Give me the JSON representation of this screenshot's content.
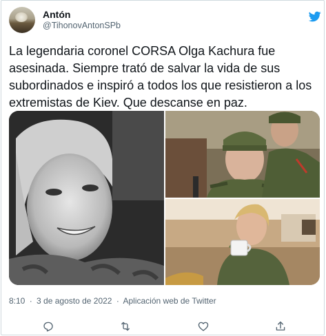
{
  "author": {
    "name": "Antón",
    "handle": "@TihonovAntonSPb",
    "avatar_icon": "avatar-photo"
  },
  "tweet": {
    "text": "La legendaria coronel CORSA Olga Kachura fue asesinada. Siempre trató de salvar la vida de sus subordinados e inspiró a todos los que resistieron a los extremistas de Kiev. Que descanse en paz."
  },
  "media": {
    "photos": [
      {
        "description_icon": "photo-portrait-bw"
      },
      {
        "description_icon": "photo-soldiers"
      },
      {
        "description_icon": "photo-cup"
      }
    ]
  },
  "meta": {
    "time": "8:10",
    "separator": "·",
    "date": "3 de agosto de 2022",
    "source": "Aplicación web de Twitter"
  },
  "actions": {
    "reply_icon": "reply-icon",
    "retweet_icon": "retweet-icon",
    "like_icon": "heart-icon",
    "share_icon": "share-icon"
  },
  "colors": {
    "brand": "#1d9bf0",
    "text": "#0f1419",
    "secondary": "#536471",
    "border": "#cfd9de"
  }
}
